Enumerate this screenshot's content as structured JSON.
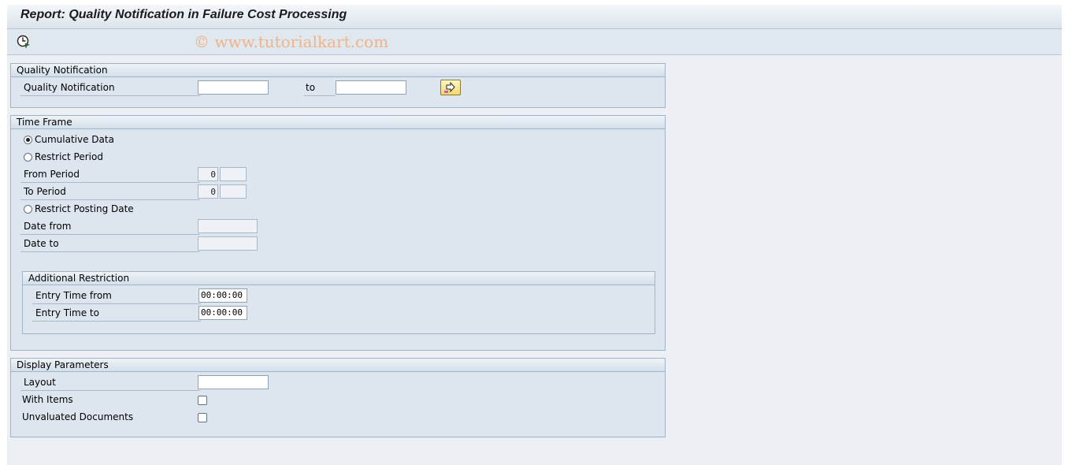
{
  "window": {
    "title": "Report: Quality Notification in Failure Cost Processing",
    "watermark": "© www.tutorialkart.com"
  },
  "toolbar": {
    "execute_icon": "execute-clock-icon"
  },
  "quality_notification": {
    "group_title": "Quality Notification",
    "label": "Quality Notification",
    "from_value": "",
    "to_label": "to",
    "to_value": "",
    "multiple_selection_icon": "multiple-selection-arrow-icon"
  },
  "time_frame": {
    "group_title": "Time Frame",
    "cumulative_label": "Cumulative Data",
    "cumulative_selected": true,
    "restrict_period_label": "Restrict Period",
    "from_period_label": "From Period",
    "from_period_value": "0",
    "from_period_year": "",
    "to_period_label": "To Period",
    "to_period_value": "0",
    "to_period_year": "",
    "restrict_posting_label": "Restrict Posting Date",
    "date_from_label": "Date from",
    "date_from_value": "",
    "date_to_label": "Date to",
    "date_to_value": "",
    "additional": {
      "group_title": "Additional Restriction",
      "entry_time_from_label": "Entry Time from",
      "entry_time_from_value": "00:00:00",
      "entry_time_to_label": "Entry Time to",
      "entry_time_to_value": "00:00:00"
    }
  },
  "display": {
    "group_title": "Display Parameters",
    "layout_label": "Layout",
    "layout_value": "",
    "with_items_label": "With Items",
    "with_items_checked": false,
    "unvaluated_label": "Unvaluated Documents",
    "unvaluated_checked": false
  }
}
